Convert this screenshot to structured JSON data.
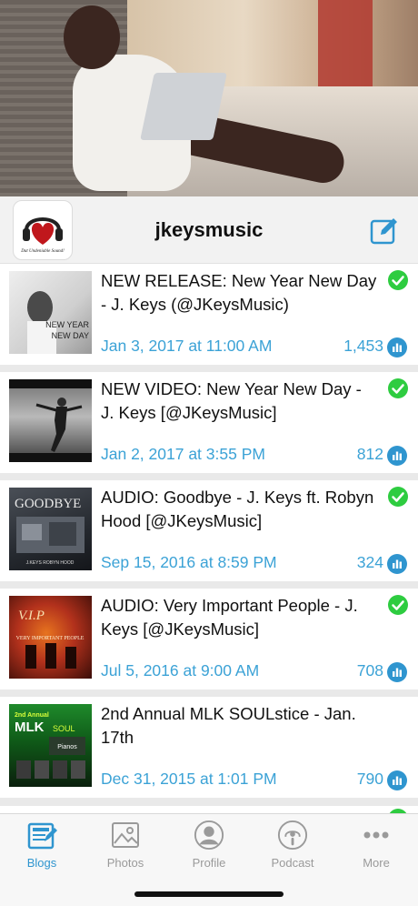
{
  "profile": {
    "name": "jkeysmusic",
    "logo_text": "Dat Undeniable Sound!"
  },
  "posts": [
    {
      "title": "NEW RELEASE: New Year New Day - J. Keys (@JKeysMusic)",
      "date": "Jan 3, 2017 at 11:00 AM",
      "views": "1,453",
      "thumb_text": "NEW YEAR NEW DAY",
      "published": true
    },
    {
      "title": "NEW VIDEO: New Year New Day - J. Keys [@JKeysMusic]",
      "date": "Jan 2, 2017 at 3:55 PM",
      "views": "812",
      "thumb_text": "",
      "published": true
    },
    {
      "title": "AUDIO: Goodbye - J. Keys ft. Robyn Hood [@JKeysMusic]",
      "date": "Sep 15, 2016 at 8:59 PM",
      "views": "324",
      "thumb_text": "GOODBYE",
      "published": true
    },
    {
      "title": "AUDIO: Very Important People - J. Keys [@JKeysMusic]",
      "date": "Jul 5, 2016 at 9:00 AM",
      "views": "708",
      "thumb_text": "VERY IMPORTANT PEOPLE",
      "published": true
    },
    {
      "title": "2nd Annual MLK SOULstice - Jan. 17th",
      "date": "Dec 31, 2015 at 1:01 PM",
      "views": "790",
      "thumb_text": "MLK SOULstice",
      "published": false
    }
  ],
  "tabs": [
    {
      "label": "Blogs",
      "icon": "blog-icon",
      "active": true
    },
    {
      "label": "Photos",
      "icon": "photo-icon",
      "active": false
    },
    {
      "label": "Profile",
      "icon": "profile-icon",
      "active": false
    },
    {
      "label": "Podcast",
      "icon": "podcast-icon",
      "active": false
    },
    {
      "label": "More",
      "icon": "more-icon",
      "active": false
    }
  ],
  "colors": {
    "accent": "#2f95cf",
    "date_blue": "#3ba2d6",
    "check_green": "#2ecc40",
    "inactive_gray": "#9a9a9a"
  }
}
